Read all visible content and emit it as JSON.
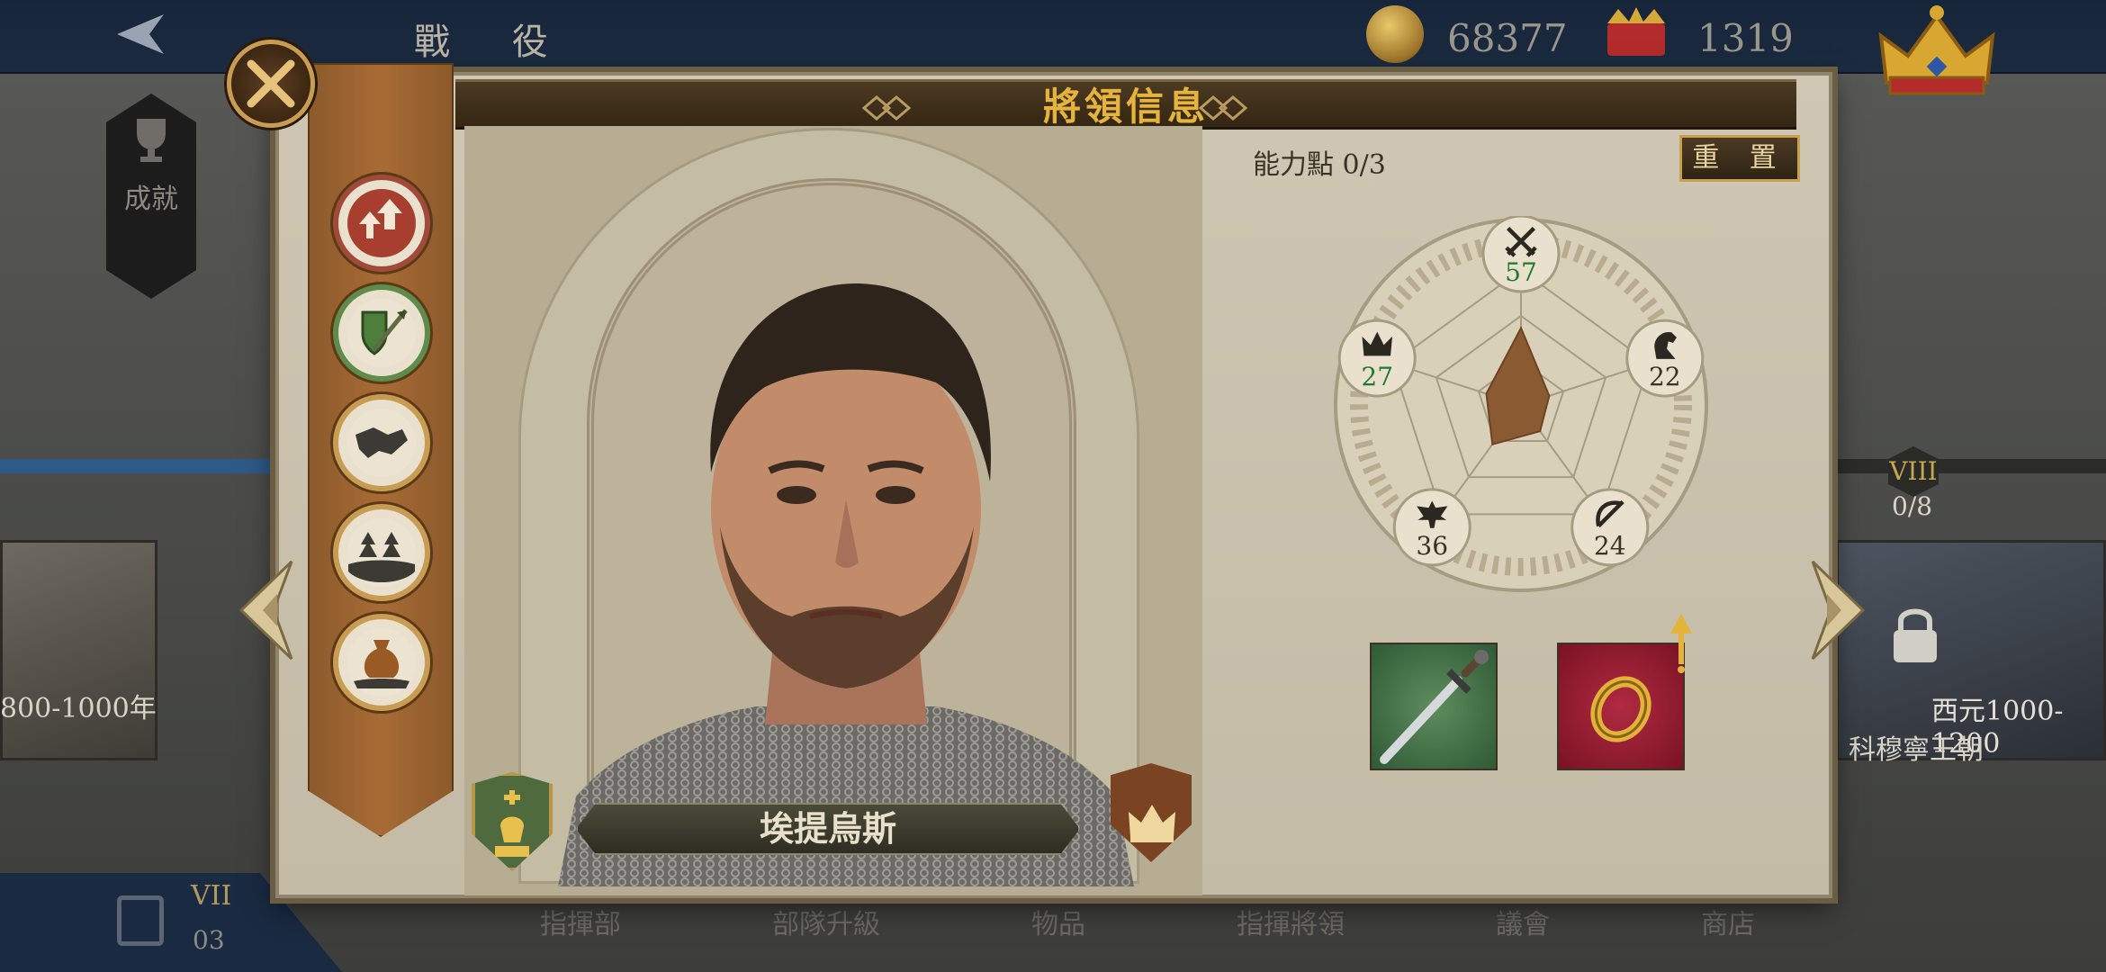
{
  "background": {
    "top_title": "戰 役",
    "gold": "68377",
    "crowns": "1319",
    "achievement_label": "成就",
    "left_era": "800-1000年",
    "right_era": "西元1000-1200",
    "right_dynasty": "科穆寧王朝",
    "chapter_numeral": "VIII",
    "chapter_progress": "0/8",
    "save_numeral": "VII",
    "save_number": "03",
    "bottom_tabs": [
      "指揮部",
      "部隊升級",
      "物品",
      "指揮將領",
      "議會",
      "商店"
    ]
  },
  "modal": {
    "title": "將領信息",
    "general_name": "埃提烏斯",
    "ability_points": "能力點 0/3",
    "reset_label": "重 置",
    "stats": [
      {
        "name": "attack",
        "value": "57",
        "color": "#1f7a2e",
        "icon": "crossed-swords-icon"
      },
      {
        "name": "cavalry",
        "value": "22",
        "color": "#3a3326",
        "icon": "knight-icon"
      },
      {
        "name": "archery",
        "value": "24",
        "color": "#3a3326",
        "icon": "bow-icon"
      },
      {
        "name": "infantry",
        "value": "36",
        "color": "#3a3326",
        "icon": "eagle-icon"
      },
      {
        "name": "leadership",
        "value": "27",
        "color": "#1f7a2e",
        "icon": "crown-icon"
      }
    ],
    "stat_max": 100,
    "items": [
      {
        "name": "sword",
        "icon": "sword-icon"
      },
      {
        "name": "ring",
        "icon": "ring-icon"
      }
    ],
    "skills": [
      {
        "icon": "charge-arrows-icon"
      },
      {
        "icon": "shield-spear-icon"
      },
      {
        "icon": "handshake-icon"
      },
      {
        "icon": "forest-icon"
      },
      {
        "icon": "supply-bag-icon"
      }
    ]
  }
}
